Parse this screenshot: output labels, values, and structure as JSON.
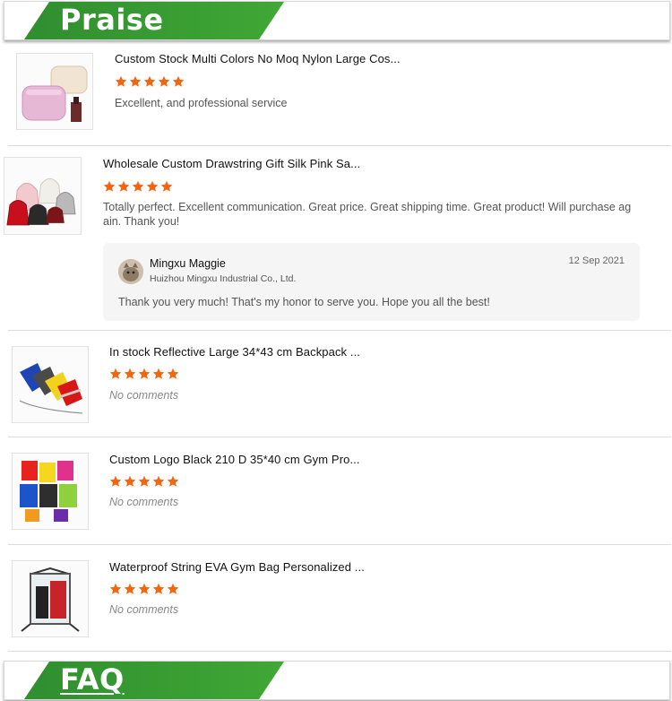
{
  "praise_banner": {
    "title": "Praise"
  },
  "faq_banner": {
    "title": "FAQ"
  },
  "colors": {
    "banner_green": "#3a9e33",
    "star_orange": "#f5640f",
    "reply_bg": "#f5f5f5"
  },
  "reviews": [
    {
      "product_title": "Custom Stock Multi Colors No Moq Nylon Large Cos...",
      "thumbnail": "pink-cosmetic-bag-image",
      "rating": 5,
      "comment": "Excellent, and professional service"
    },
    {
      "product_title": "Wholesale Custom Drawstring Gift Silk Pink Sa...",
      "thumbnail": "drawstring-gift-pouches-image",
      "rating": 5,
      "comment_line1": "Totally perfect. Excellent communication. Great price. Great shipping time. Great product! Will purchase ag",
      "comment_line2": "ain. Thank you!",
      "reply": {
        "name": "Mingxu Maggie",
        "company": "Huizhou Mingxu Industrial Co., Ltd.",
        "date": "12 Sep 2021",
        "message": "Thank you very much! That's my honor to serve you. Hope you all the best!"
      }
    },
    {
      "product_title": "In stock Reflective Large 34*43 cm Backpack ...",
      "thumbnail": "reflective-drawstring-backpacks-image",
      "rating": 5,
      "comment": "No comments"
    },
    {
      "product_title": "Custom Logo Black 210 D 35*40 cm Gym Pro...",
      "thumbnail": "colorful-gym-bags-image",
      "rating": 5,
      "comment": "No comments"
    },
    {
      "product_title": "Waterproof String EVA Gym Bag Personalized ...",
      "thumbnail": "clear-eva-gym-bag-image",
      "rating": 5,
      "comment": "No comments"
    }
  ]
}
